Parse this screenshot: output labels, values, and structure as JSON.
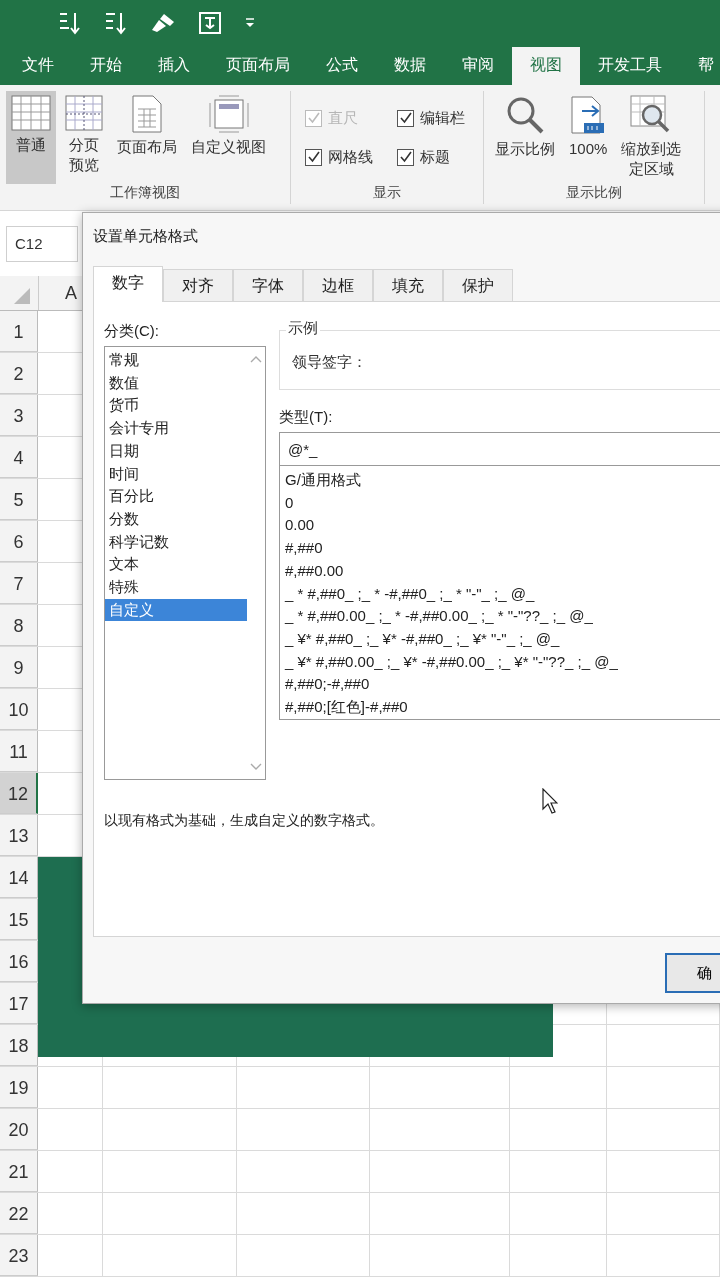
{
  "ribbon_tabs": [
    {
      "label": "文件",
      "selected": false
    },
    {
      "label": "开始",
      "selected": false
    },
    {
      "label": "插入",
      "selected": false
    },
    {
      "label": "页面布局",
      "selected": false
    },
    {
      "label": "公式",
      "selected": false
    },
    {
      "label": "数据",
      "selected": false
    },
    {
      "label": "审阅",
      "selected": false
    },
    {
      "label": "视图",
      "selected": true
    },
    {
      "label": "开发工具",
      "selected": false
    },
    {
      "label": "帮",
      "selected": false
    }
  ],
  "ribbon_groups": [
    {
      "label": "工作簿视图",
      "kind": "buttons",
      "items": [
        {
          "label": "普通",
          "selected": true
        },
        {
          "label": "分页预览",
          "selected": false
        },
        {
          "label": "页面布局",
          "selected": false
        },
        {
          "label": "自定义视图",
          "selected": false
        }
      ]
    },
    {
      "label": "显示",
      "kind": "checkboxes",
      "items": [
        {
          "label": "直尺",
          "checked": true,
          "disabled": true
        },
        {
          "label": "编辑栏",
          "checked": true,
          "disabled": false
        },
        {
          "label": "网格线",
          "checked": true,
          "disabled": false
        },
        {
          "label": "标题",
          "checked": true,
          "disabled": false
        }
      ]
    },
    {
      "label": "显示比例",
      "kind": "buttons",
      "items": [
        {
          "label": "显示比例",
          "selected": false
        },
        {
          "label": "100%",
          "selected": false
        },
        {
          "label": "缩放到选定区域",
          "selected": false
        }
      ]
    }
  ],
  "name_box": "C12",
  "sheet": {
    "columns": [
      {
        "label": "A"
      }
    ],
    "rows": [
      {
        "label": "1",
        "selected": false
      },
      {
        "label": "2",
        "selected": false
      },
      {
        "label": "3",
        "selected": false
      },
      {
        "label": "4",
        "selected": false
      },
      {
        "label": "5",
        "selected": false
      },
      {
        "label": "6",
        "selected": false
      },
      {
        "label": "7",
        "selected": false
      },
      {
        "label": "8",
        "selected": false
      },
      {
        "label": "9",
        "selected": false
      },
      {
        "label": "10",
        "selected": false
      },
      {
        "label": "11",
        "selected": false
      },
      {
        "label": "12",
        "selected": true
      },
      {
        "label": "13",
        "selected": false
      },
      {
        "label": "14",
        "selected": false
      },
      {
        "label": "15",
        "selected": false
      },
      {
        "label": "16",
        "selected": false
      },
      {
        "label": "17",
        "selected": false
      },
      {
        "label": "18",
        "selected": false
      },
      {
        "label": "19",
        "selected": false
      },
      {
        "label": "20",
        "selected": false
      },
      {
        "label": "21",
        "selected": false
      },
      {
        "label": "22",
        "selected": false
      },
      {
        "label": "23",
        "selected": false
      }
    ]
  },
  "dialog": {
    "title": "设置单元格格式",
    "tabs": [
      {
        "label": "数字",
        "selected": true
      },
      {
        "label": "对齐",
        "selected": false
      },
      {
        "label": "字体",
        "selected": false
      },
      {
        "label": "边框",
        "selected": false
      },
      {
        "label": "填充",
        "selected": false
      },
      {
        "label": "保护",
        "selected": false
      }
    ],
    "category_label": "分类(C):",
    "categories": [
      {
        "label": "常规",
        "selected": false
      },
      {
        "label": "数值",
        "selected": false
      },
      {
        "label": "货币",
        "selected": false
      },
      {
        "label": "会计专用",
        "selected": false
      },
      {
        "label": "日期",
        "selected": false
      },
      {
        "label": "时间",
        "selected": false
      },
      {
        "label": "百分比",
        "selected": false
      },
      {
        "label": "分数",
        "selected": false
      },
      {
        "label": "科学记数",
        "selected": false
      },
      {
        "label": "文本",
        "selected": false
      },
      {
        "label": "特殊",
        "selected": false
      },
      {
        "label": "自定义",
        "selected": true
      }
    ],
    "sample_legend": "示例",
    "sample_value": "领导签字：",
    "type_label": "类型(T):",
    "type_value": "@*_",
    "formats": [
      "G/通用格式",
      "0",
      "0.00",
      "#,##0",
      "#,##0.00",
      "_ * #,##0_ ;_ * -#,##0_ ;_ * \"-\"_ ;_ @_",
      "_ * #,##0.00_ ;_ * -#,##0.00_ ;_ * \"-\"??_ ;_ @_",
      "_ ¥* #,##0_ ;_ ¥* -#,##0_ ;_ ¥* \"-\"_ ;_ @_",
      "_ ¥* #,##0.00_ ;_ ¥* -#,##0.00_ ;_ ¥* \"-\"??_ ;_ @_",
      "#,##0;-#,##0",
      "#,##0;[红色]-#,##0"
    ],
    "description": "以现有格式为基础，生成自定义的数字格式。",
    "buttons": [
      "确"
    ]
  }
}
